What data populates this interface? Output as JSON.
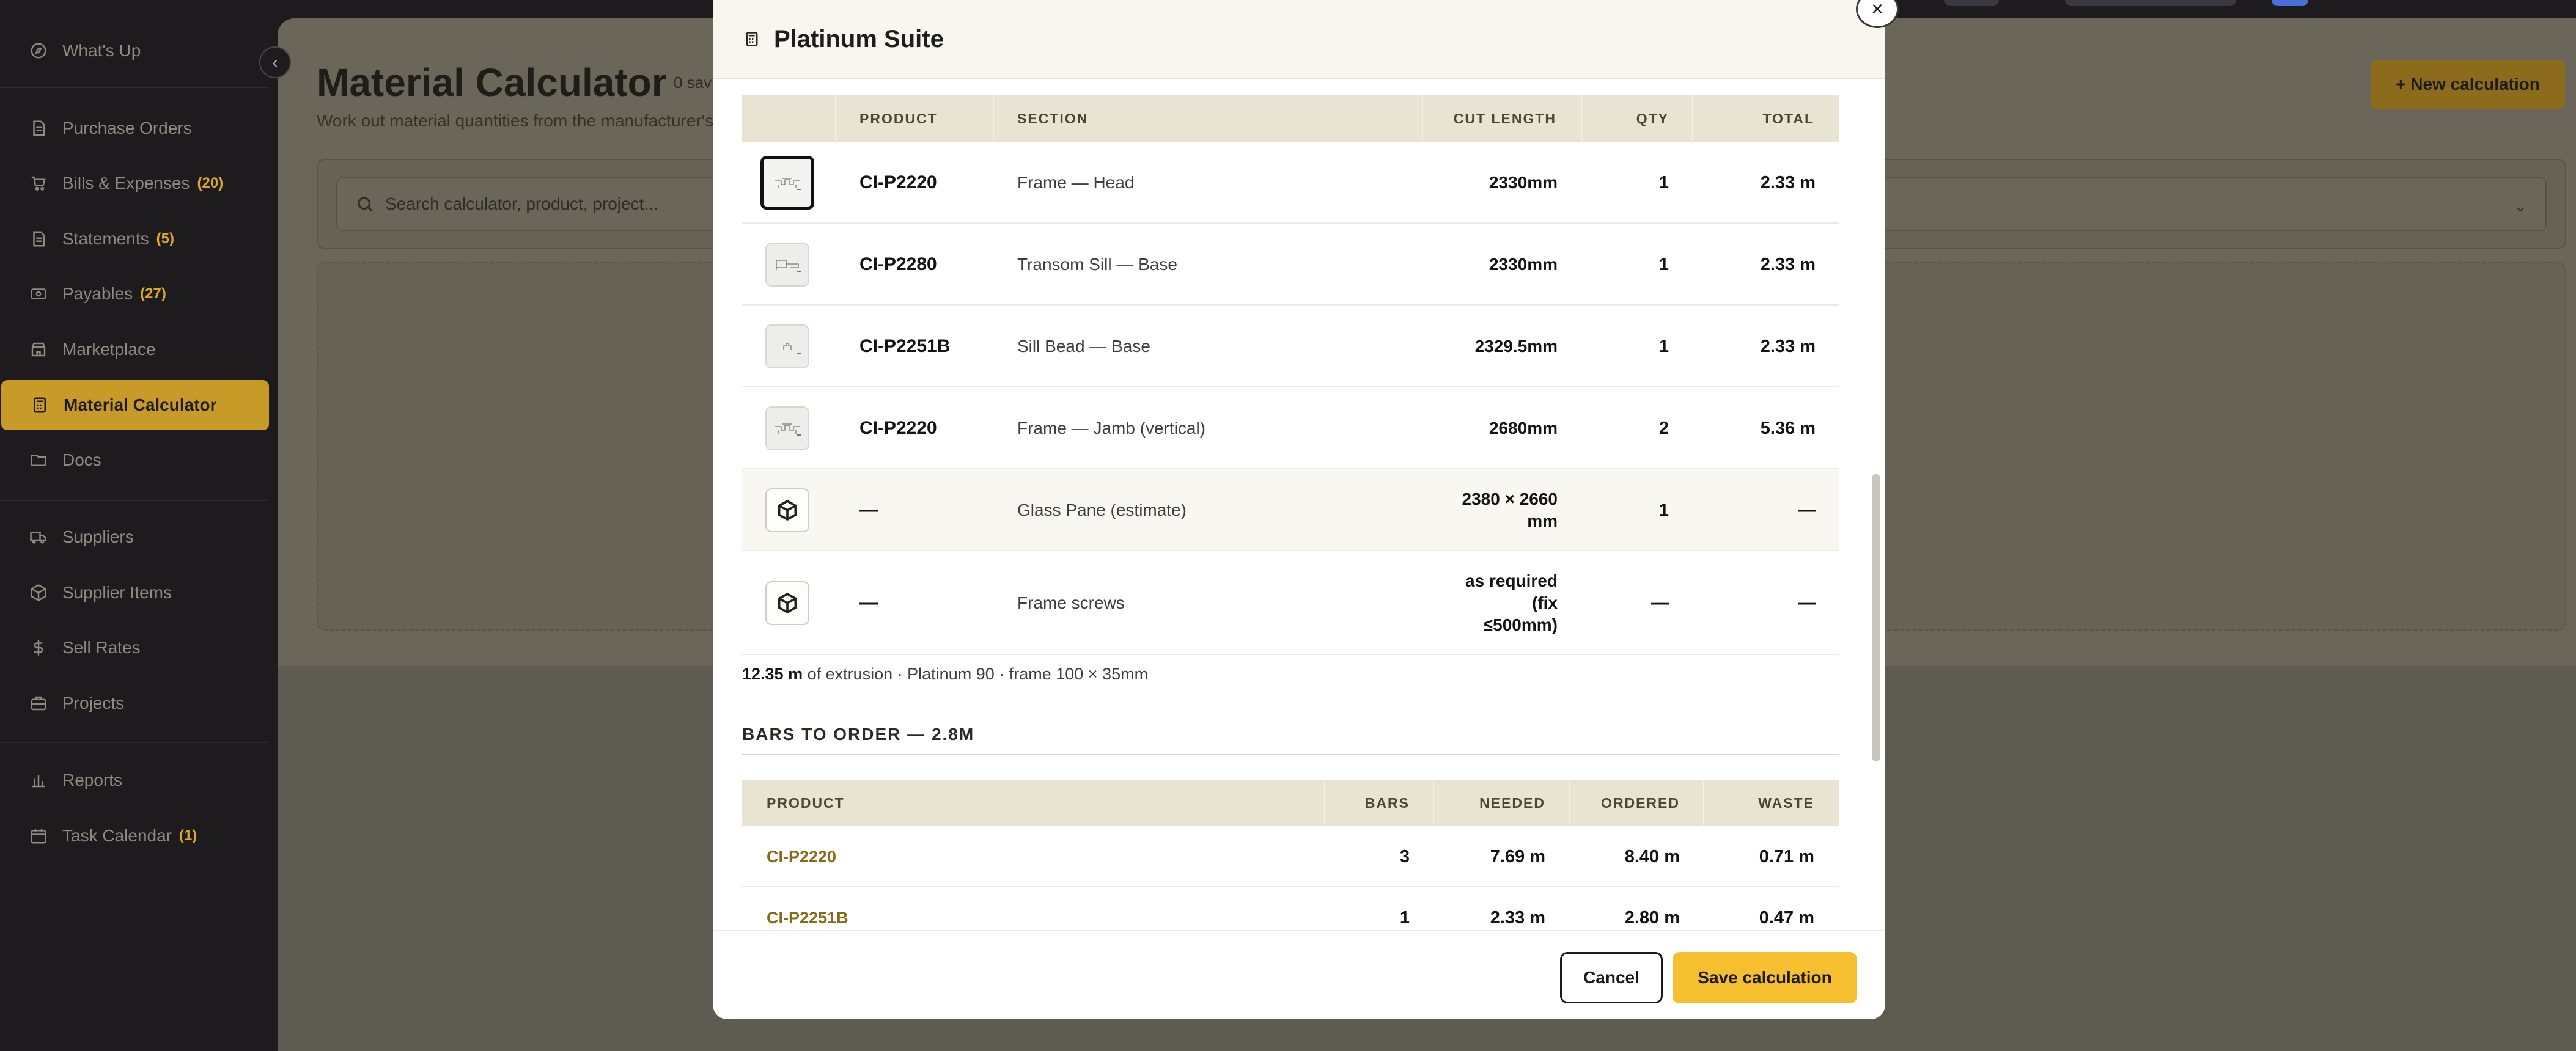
{
  "sidebar": {
    "items": [
      {
        "label": "What's Up",
        "icon": "compass-icon",
        "badge": ""
      },
      {
        "label": "Purchase Orders",
        "icon": "document-icon",
        "badge": ""
      },
      {
        "label": "Bills & Expenses",
        "icon": "cart-icon",
        "badge": "(20)"
      },
      {
        "label": "Statements",
        "icon": "document-icon",
        "badge": "(5)"
      },
      {
        "label": "Payables",
        "icon": "banknote-icon",
        "badge": "(27)"
      },
      {
        "label": "Marketplace",
        "icon": "store-icon",
        "badge": ""
      },
      {
        "label": "Material Calculator",
        "icon": "calculator-icon",
        "badge": "",
        "active": true
      },
      {
        "label": "Docs",
        "icon": "folder-icon",
        "badge": ""
      },
      {
        "label": "Suppliers",
        "icon": "truck-icon",
        "badge": ""
      },
      {
        "label": "Supplier Items",
        "icon": "box-icon",
        "badge": ""
      },
      {
        "label": "Sell Rates",
        "icon": "dollar-icon",
        "badge": ""
      },
      {
        "label": "Projects",
        "icon": "briefcase-icon",
        "badge": ""
      },
      {
        "label": "Reports",
        "icon": "bar-chart-icon",
        "badge": ""
      },
      {
        "label": "Task Calendar",
        "icon": "calendar-icon",
        "badge": "(1)"
      }
    ]
  },
  "page": {
    "title": "Material Calculator",
    "saved_count": "0 sav",
    "subtitle": "Work out material quantities from the manufacturer's",
    "new_button": "+ New calculation",
    "search_placeholder": "Search calculator, product, project..."
  },
  "modal": {
    "title": "Platinum Suite",
    "close_label": "×",
    "parts_table": {
      "headers": [
        "PRODUCT",
        "SECTION",
        "CUT LENGTH",
        "QTY",
        "TOTAL"
      ],
      "rows": [
        {
          "product": "CI-P2220",
          "section": "Frame — Head",
          "cut_length": "2330mm",
          "qty": "1",
          "total": "2.33 m",
          "thumb": "profile-thumbnail",
          "selected": true
        },
        {
          "product": "CI-P2280",
          "section": "Transom Sill — Base",
          "cut_length": "2330mm",
          "qty": "1",
          "total": "2.33 m",
          "thumb": "profile-thumbnail"
        },
        {
          "product": "CI-P2251B",
          "section": "Sill Bead — Base",
          "cut_length": "2329.5mm",
          "qty": "1",
          "total": "2.33 m",
          "thumb": "profile-thumbnail"
        },
        {
          "product": "CI-P2220",
          "section": "Frame — Jamb (vertical)",
          "cut_length": "2680mm",
          "qty": "2",
          "total": "5.36 m",
          "thumb": "profile-thumbnail"
        },
        {
          "product": "—",
          "section": "Glass Pane (estimate)",
          "cut_length_lines": [
            "2380 × 2660",
            "mm"
          ],
          "qty": "1",
          "total": "—",
          "thumb": "package-icon"
        },
        {
          "product": "—",
          "section": "Frame screws",
          "cut_length_lines": [
            "as required",
            "(fix",
            "≤500mm)"
          ],
          "qty": "—",
          "total": "—",
          "thumb": "package-icon"
        }
      ]
    },
    "summary": {
      "length": "12.35 m",
      "rest": " of extrusion · Platinum 90 · frame 100 × 35mm"
    },
    "bars": {
      "heading": "BARS TO ORDER — 2.8M",
      "headers": [
        "PRODUCT",
        "BARS",
        "NEEDED",
        "ORDERED",
        "WASTE"
      ],
      "rows": [
        {
          "product": "CI-P2220",
          "bars": "3",
          "needed": "7.69 m",
          "ordered": "8.40 m",
          "waste": "0.71 m"
        },
        {
          "product": "CI-P2251B",
          "bars": "1",
          "needed": "2.33 m",
          "ordered": "2.80 m",
          "waste": "0.47 m"
        }
      ]
    },
    "footer": {
      "cancel": "Cancel",
      "save": "Save calculation"
    }
  },
  "colors": {
    "accent": "#f5bf2f",
    "sidebar_active": "#c89a27",
    "link": "#8a6a14",
    "sidebar_bg": "#1d1b1e"
  }
}
